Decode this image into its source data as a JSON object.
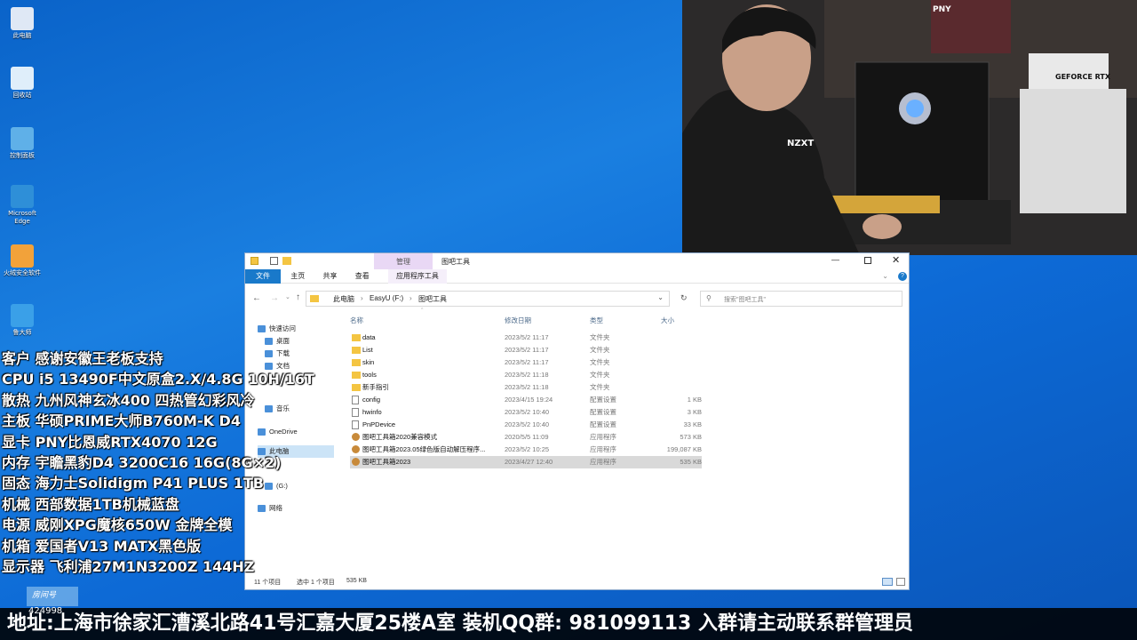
{
  "desktop": {
    "icons": [
      {
        "label": "此电脑",
        "icon": "computer-icon"
      },
      {
        "label": "回收站",
        "icon": "recycle-bin-icon"
      },
      {
        "label": "控制面板",
        "icon": "control-panel-icon"
      },
      {
        "label": "Microsoft Edge",
        "icon": "edge-icon"
      },
      {
        "label": "火绒安全软件",
        "icon": "huorong-icon"
      },
      {
        "label": "鲁大师",
        "icon": "ludashi-icon"
      }
    ],
    "taskbar_room": {
      "label": "房间号",
      "number": "424998"
    }
  },
  "explorer": {
    "title": "图吧工具",
    "context_tab": "管理",
    "ribbon_tabs": [
      "文件",
      "主页",
      "共享",
      "查看",
      "应用程序工具"
    ],
    "breadcrumb": [
      "此电脑",
      "EasyU (F:)",
      "图吧工具"
    ],
    "search_placeholder": "搜索\"图吧工具\"",
    "columns": [
      "名称",
      "修改日期",
      "类型",
      "大小"
    ],
    "nav": [
      {
        "label": "快速访问",
        "icon": "star-icon"
      },
      {
        "label": "桌面",
        "icon": "desktop-folder-icon"
      },
      {
        "label": "下载",
        "icon": "download-icon"
      },
      {
        "label": "文档",
        "icon": "document-icon"
      },
      {
        "label": "音乐",
        "icon": "music-icon"
      },
      {
        "label": "OneDrive",
        "icon": "onedrive-icon"
      },
      {
        "label": "此电脑",
        "icon": "computer-icon"
      },
      {
        "label": "(G:)",
        "icon": "drive-icon"
      },
      {
        "label": "网络",
        "icon": "network-icon"
      }
    ],
    "files": [
      {
        "name": "data",
        "date": "2023/5/2 11:17",
        "type": "文件夹",
        "size": "",
        "kind": "folder"
      },
      {
        "name": "List",
        "date": "2023/5/2 11:17",
        "type": "文件夹",
        "size": "",
        "kind": "folder"
      },
      {
        "name": "skin",
        "date": "2023/5/2 11:17",
        "type": "文件夹",
        "size": "",
        "kind": "folder"
      },
      {
        "name": "tools",
        "date": "2023/5/2 11:18",
        "type": "文件夹",
        "size": "",
        "kind": "folder"
      },
      {
        "name": "新手指引",
        "date": "2023/5/2 11:18",
        "type": "文件夹",
        "size": "",
        "kind": "folder"
      },
      {
        "name": "config",
        "date": "2023/4/15 19:24",
        "type": "配置设置",
        "size": "1 KB",
        "kind": "config"
      },
      {
        "name": "hwinfo",
        "date": "2023/5/2 10:40",
        "type": "配置设置",
        "size": "3 KB",
        "kind": "config"
      },
      {
        "name": "PnPDevice",
        "date": "2023/5/2 10:40",
        "type": "配置设置",
        "size": "33 KB",
        "kind": "config"
      },
      {
        "name": "图吧工具箱2020兼容模式",
        "date": "2020/5/5 11:09",
        "type": "应用程序",
        "size": "573 KB",
        "kind": "app"
      },
      {
        "name": "图吧工具箱2023.05绿色版自动解压程序...",
        "date": "2023/5/2 10:25",
        "type": "应用程序",
        "size": "199,087 KB",
        "kind": "app"
      },
      {
        "name": "图吧工具箱2023",
        "date": "2023/4/27 12:40",
        "type": "应用程序",
        "size": "535 KB",
        "kind": "app"
      }
    ],
    "status": {
      "count": "11 个项目",
      "selected": "选中 1 个项目",
      "size": "535 KB"
    }
  },
  "overlay_specs": [
    "客户 感谢安徽王老板支持",
    "CPU i5 13490F中文原盒2.X/4.8G 10H/16T",
    "散热 九州风神玄冰400 四热管幻彩风冷",
    "主板 华硕PRIME大师B760M-K D4",
    "显卡 PNY比恩威RTX4070 12G",
    "内存 宇瞻黑豹D4 3200C16 16G(8G×2)",
    "固态 海力士Solidigm P41 PLUS 1TB",
    "机械 西部数据1TB机械蓝盘",
    "电源 威刚XPG魔核650W 金牌全模",
    "机箱 爱国者V13 MATX黑色版",
    "显示器 飞利浦27M1N3200Z 144HZ"
  ],
  "bottom_banner": "地址:上海市徐家汇漕溪北路41号汇嘉大厦25楼A室  装机QQ群: 981099113 入群请主动联系群管理员",
  "camera": {
    "brand_signs": [
      "PNY",
      "GEFORCE RTX",
      "NZXT"
    ]
  }
}
